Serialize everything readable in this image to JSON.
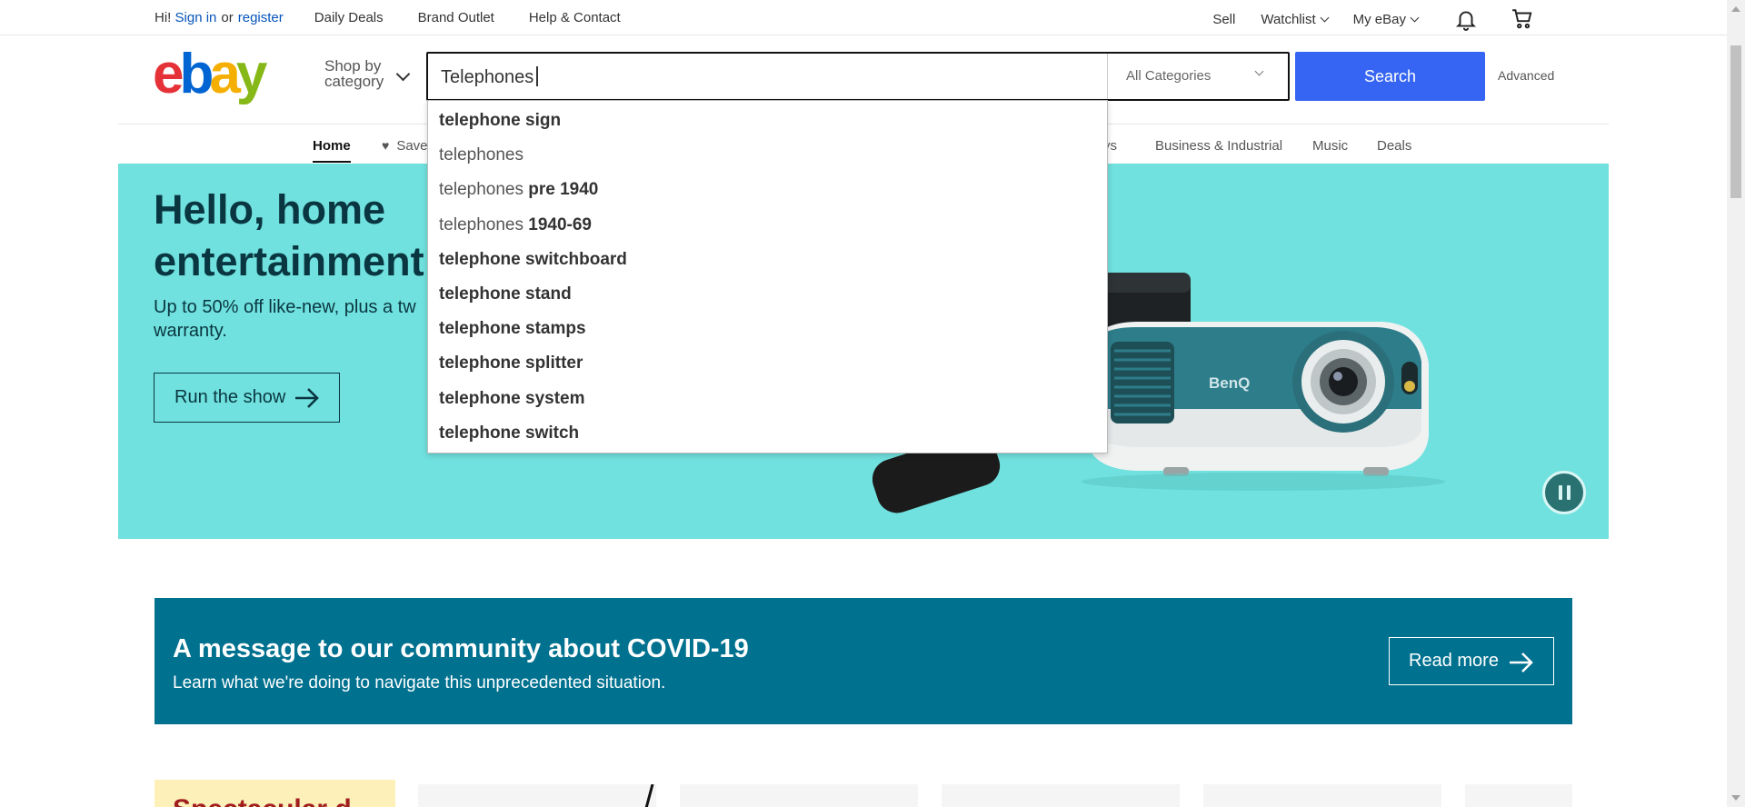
{
  "topbar": {
    "greeting": "Hi!",
    "sign_in": "Sign in",
    "or": "or",
    "register": "register",
    "links": [
      "Daily Deals",
      "Brand Outlet",
      "Help & Contact"
    ],
    "sell": "Sell",
    "watchlist": "Watchlist",
    "my_ebay": "My eBay"
  },
  "header": {
    "shop_by_line1": "Shop by",
    "shop_by_line2": "category",
    "search_value": "Telephones",
    "category": "All Categories",
    "search_button": "Search",
    "advanced": "Advanced"
  },
  "nav": {
    "home": "Home",
    "saved": "Save",
    "ys": "ys",
    "business": "Business & Industrial",
    "music": "Music",
    "deals": "Deals"
  },
  "suggestions": [
    {
      "pre": "",
      "post": "telephone sign"
    },
    {
      "pre": "telephones",
      "post": ""
    },
    {
      "pre": "telephones ",
      "post": "pre 1940"
    },
    {
      "pre": "telephones ",
      "post": "1940-69"
    },
    {
      "pre": "",
      "post": "telephone switchboard"
    },
    {
      "pre": "",
      "post": "telephone stand"
    },
    {
      "pre": "",
      "post": "telephone stamps"
    },
    {
      "pre": "",
      "post": "telephone splitter"
    },
    {
      "pre": "",
      "post": "telephone system"
    },
    {
      "pre": "",
      "post": "telephone switch"
    }
  ],
  "hero": {
    "title_line1": "Hello, home",
    "title_line2": "entertainment",
    "subtitle_line1": "Up to 50% off like-new, plus a tw",
    "subtitle_line2": "warranty.",
    "button": "Run the show",
    "brand_on_product": "BenQ",
    "bg_color": "#70e1de"
  },
  "covid": {
    "title": "A message to our community about COVID-19",
    "subtitle": "Learn what we're doing to navigate this unprecedented situation.",
    "button": "Read more",
    "bg_color": "#00718f"
  },
  "tiles": {
    "promo_partial": "Spectacular d"
  },
  "colors": {
    "accent": "#3665f3",
    "link": "#0654ba"
  }
}
